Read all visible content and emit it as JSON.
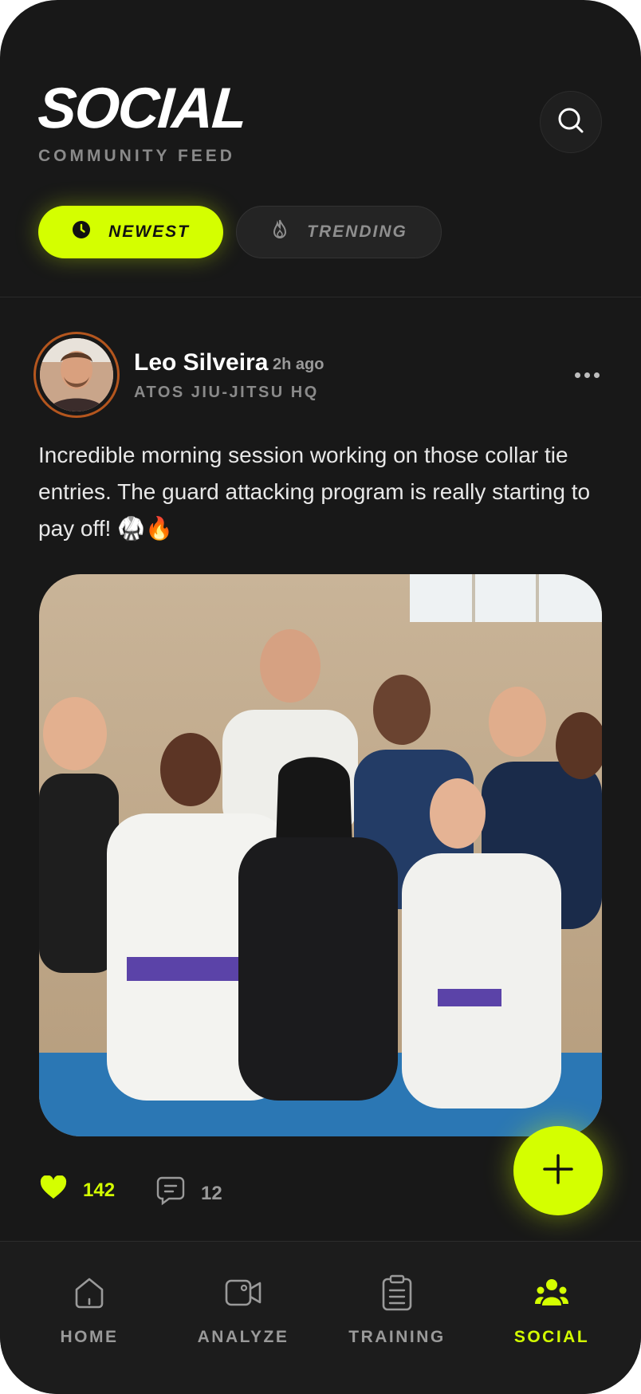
{
  "header": {
    "title": "SOCIAL",
    "subtitle": "COMMUNITY FEED"
  },
  "tabs": [
    {
      "label": "NEWEST",
      "icon": "clock-icon",
      "active": true
    },
    {
      "label": "TRENDING",
      "icon": "flame-icon",
      "active": false
    }
  ],
  "post": {
    "author": "Leo Silveira",
    "time": "2h ago",
    "gym": "ATOS JIU-JITSU HQ",
    "text": "Incredible morning session working on those collar tie entries. The guard attacking program is really starting to pay off! 🥋🔥",
    "likes": "142",
    "comments": "12",
    "peek_count": "8"
  },
  "nav": [
    {
      "label": "HOME",
      "icon": "home-icon",
      "active": false
    },
    {
      "label": "ANALYZE",
      "icon": "video-camera-icon",
      "active": false
    },
    {
      "label": "TRAINING",
      "icon": "clipboard-icon",
      "active": false
    },
    {
      "label": "SOCIAL",
      "icon": "users-icon",
      "active": true
    }
  ],
  "colors": {
    "background": "#181818",
    "accent": "#d4ff00",
    "avatar_ring": "#b4561e"
  }
}
